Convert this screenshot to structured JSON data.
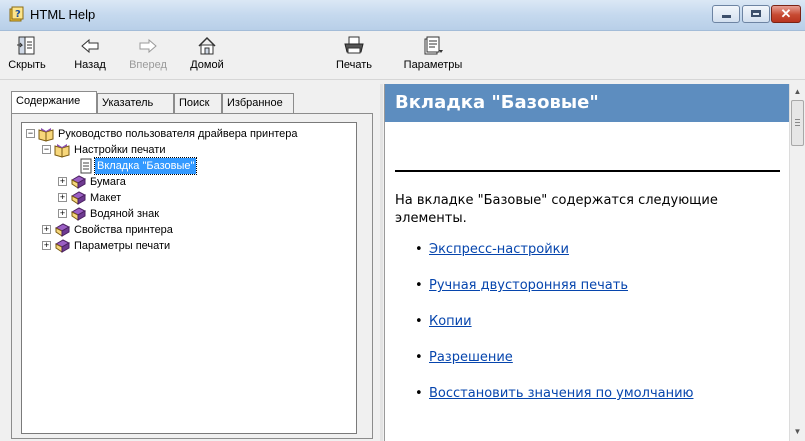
{
  "window": {
    "title": "HTML Help"
  },
  "toolbar": {
    "hide": "Скрыть",
    "back": "Назад",
    "forward": "Вперед",
    "home": "Домой",
    "print": "Печать",
    "options": "Параметры"
  },
  "tabs": [
    "Содержание",
    "Указатель",
    "Поиск",
    "Избранное"
  ],
  "tree": {
    "root": "Руководство пользователя драйвера принтера",
    "print_settings": "Настройки печати",
    "basic_tab": "Вкладка \"Базовые\"",
    "paper": "Бумага",
    "layout": "Макет",
    "watermark": "Водяной знак",
    "printer_properties": "Свойства принтера",
    "print_options": "Параметры печати"
  },
  "content": {
    "heading": "Вкладка \"Базовые\"",
    "intro": "На вкладке \"Базовые\" содержатся следующие элементы.",
    "links": [
      "Экспресс-настройки",
      "Ручная двусторонняя печать",
      "Копии",
      "Разрешение",
      "Восстановить значения по умолчанию"
    ]
  },
  "colors": {
    "heading_bar": "#5d8dbf",
    "link": "#0645ad",
    "selection": "#3399ff"
  }
}
